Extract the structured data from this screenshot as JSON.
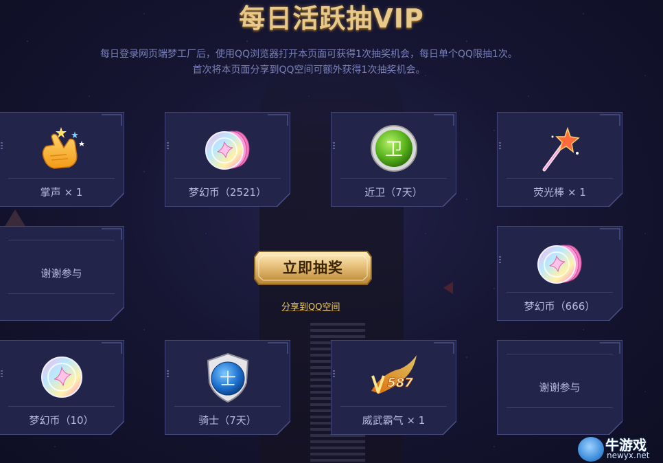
{
  "header": {
    "title": "每日活跃抽VIP",
    "desc_line1": "每日登录网页端梦工厂后，使用QQ浏览器打开本页面可获得1次抽奖机会，每日单个QQ限抽1次。",
    "desc_line2": "首次将本页面分享到QQ空间可额外获得1次抽奖机会。"
  },
  "prizes": [
    {
      "label": "掌声 × 1",
      "icon": "clapping-hands-icon"
    },
    {
      "label": "梦幻币（2521）",
      "icon": "dream-coin-stack-icon"
    },
    {
      "label": "近卫（7天）",
      "icon": "guard-badge-icon",
      "badge": "卫"
    },
    {
      "label": "荧光棒 × 1",
      "icon": "glow-stick-icon"
    },
    {
      "label": "谢谢参与"
    },
    {
      "label": "梦幻币（666）",
      "icon": "dream-coin-stack-icon"
    },
    {
      "label": "梦幻币（10）",
      "icon": "dream-coin-icon"
    },
    {
      "label": "骑士（7天）",
      "icon": "knight-shield-icon",
      "badge": "士"
    },
    {
      "label": "威武霸气 × 1",
      "icon": "vip-587-flame-icon",
      "badge": "587"
    },
    {
      "label": "谢谢参与"
    }
  ],
  "actions": {
    "draw_button": "立即抽奖",
    "share_link": "分享到QQ空间"
  },
  "watermark": {
    "brand": "牛游戏",
    "domain": "newyx.net"
  },
  "colors": {
    "background": "#161633",
    "card_fill": "#23244a",
    "card_border": "#4d5089",
    "title_gold": "#e9c98a",
    "desc_text": "#7b81b8",
    "label_text": "#b7bbdf",
    "button_gold": "#e7c07a",
    "share_link": "#f3cc55"
  }
}
